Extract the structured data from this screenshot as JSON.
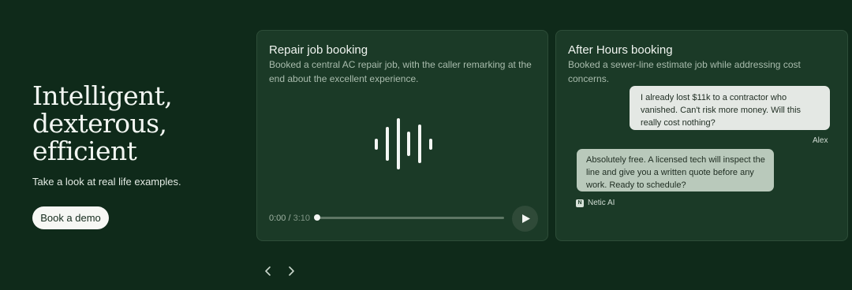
{
  "hero": {
    "title_lines": [
      "Intelligent,",
      "dexterous,",
      "efficient"
    ],
    "subtitle": "Take a look at real life examples.",
    "cta_label": "Book a demo"
  },
  "cards": [
    {
      "title": "Repair job booking",
      "description": "Booked a central AC repair job, with the caller remarking at the end about the excellent experience.",
      "icon": "audio-waveform-icon",
      "player": {
        "current_time": "0:00 /",
        "duration": "3:10",
        "progress": 0,
        "icon": "play-icon"
      }
    },
    {
      "title": "After Hours booking",
      "description": "Booked a sewer-line estimate job while addressing cost concerns.",
      "messages": [
        {
          "sender": "Alex",
          "text": "I already lost $11k to a contractor who vanished. Can't risk more money. Will this really cost nothing?"
        },
        {
          "sender": "Netic AI",
          "text": "Absolutely free. A licensed tech will inspect the line and give you a written quote before any work. Ready to schedule?",
          "logo_letter": "N"
        }
      ]
    }
  ],
  "nav": {
    "prev_icon": "chevron-left-icon",
    "next_icon": "chevron-right-icon"
  },
  "colors": {
    "background": "#0f2a1a",
    "card": "#1b3a27",
    "user_bubble": "#e4e8e4",
    "ai_bubble": "#b9c9bb"
  }
}
